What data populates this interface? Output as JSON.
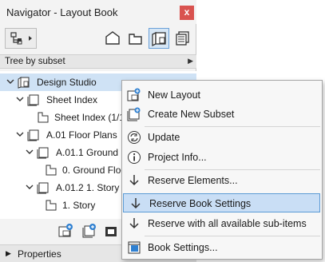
{
  "window": {
    "title": "Navigator - Layout Book",
    "close_label": "x"
  },
  "dropdown": {
    "label": "Tree by subset"
  },
  "tree": {
    "items": [
      {
        "label": "Design Studio"
      },
      {
        "label": "Sheet Index"
      },
      {
        "label": "Sheet Index (1/1)"
      },
      {
        "label": "A.01 Floor Plans"
      },
      {
        "label": "A.01.1 Ground Fl"
      },
      {
        "label": "0. Ground Floo"
      },
      {
        "label": "A.01.2 1. Story"
      },
      {
        "label": "1. Story"
      }
    ]
  },
  "properties": {
    "label": "Properties"
  },
  "menu": {
    "items": [
      {
        "label": "New Layout",
        "icon": "new-layout-icon"
      },
      {
        "label": "Create New Subset",
        "icon": "new-subset-icon"
      },
      {
        "label": "Update",
        "icon": "update-icon"
      },
      {
        "label": "Project Info...",
        "icon": "info-icon"
      },
      {
        "label": "Reserve Elements...",
        "icon": "reserve-arrow-icon"
      },
      {
        "label": "Reserve Book Settings",
        "icon": "reserve-arrow-icon"
      },
      {
        "label": "Reserve with all available sub-items",
        "icon": "reserve-arrow-icon"
      },
      {
        "label": "Book Settings...",
        "icon": "book-settings-icon"
      }
    ]
  },
  "colors": {
    "selection": "#cfe2f5",
    "menu_highlight": "#c9def5",
    "accent": "#5b9bd5",
    "close": "#d9534f"
  }
}
